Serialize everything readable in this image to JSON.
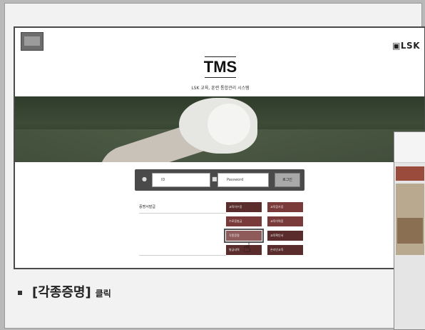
{
  "header": {
    "logo_right_text": "LSK",
    "title": "TMS",
    "subtitle": "LSK 교육, 훈련 통합관리 시스템"
  },
  "login": {
    "id_placeholder": "ID",
    "password_placeholder": "Password",
    "button_label": "로그인"
  },
  "menu": {
    "section_label": "증명서발급",
    "buttons": [
      {
        "label": "교육이수증"
      },
      {
        "label": "교육참가증"
      },
      {
        "label": "수료증발급"
      },
      {
        "label": "교육이력증"
      },
      {
        "label": "각종증명"
      },
      {
        "label": "교육확인서"
      },
      {
        "label": "발급내역"
      },
      {
        "label": "온라인교육"
      }
    ]
  },
  "instruction": {
    "main": "[각종증명]",
    "action": "클릭"
  },
  "colors": {
    "menu_button": "#7a3a3a",
    "login_bar": "#4a4a4a"
  }
}
